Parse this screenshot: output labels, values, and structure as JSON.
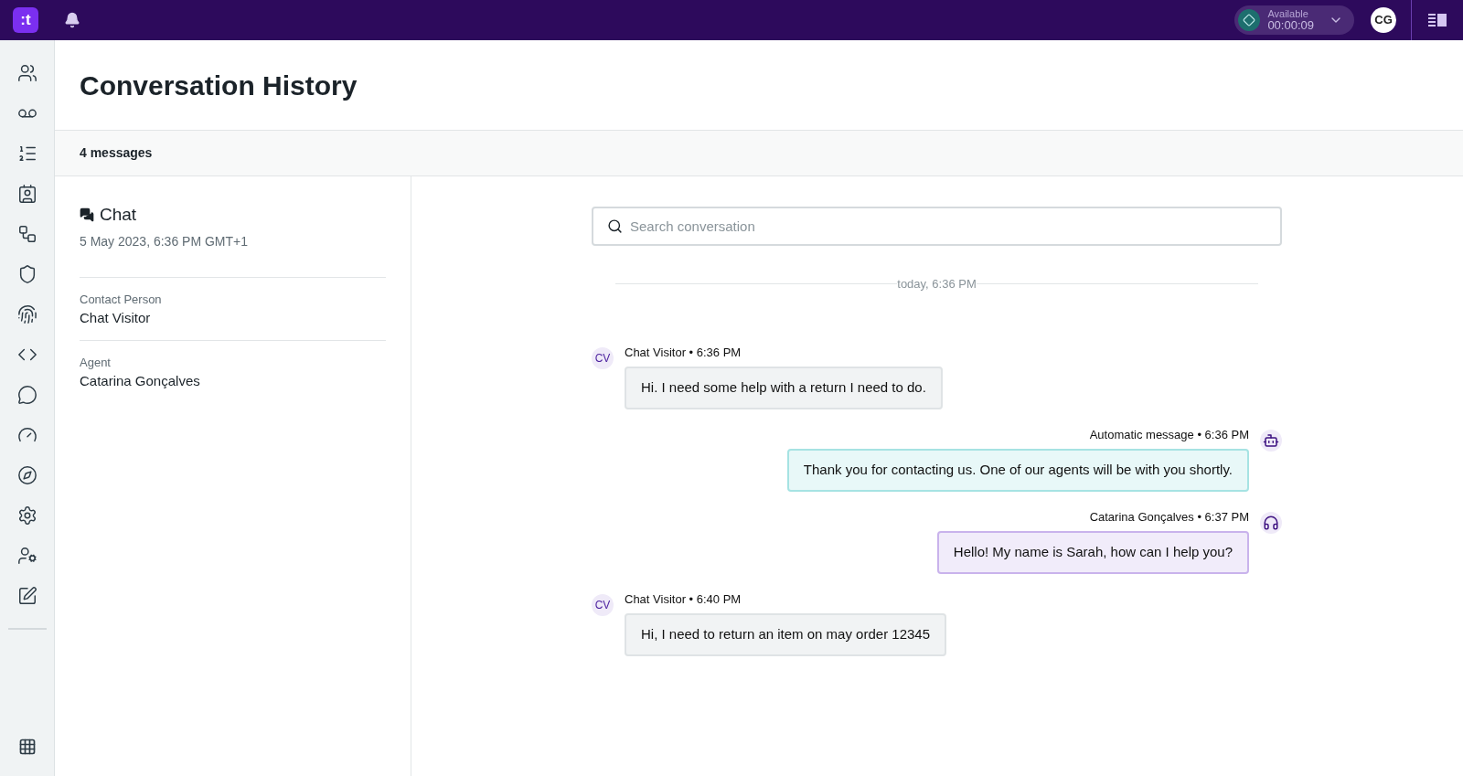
{
  "top_bar": {
    "logo": ":t",
    "status": {
      "label": "Available",
      "timer": "00:00:09"
    },
    "avatar": "CG"
  },
  "page": {
    "title": "Conversation History",
    "message_count": "4 messages"
  },
  "details": {
    "channel": "Chat",
    "date": "5 May 2023, 6:36 PM GMT+1",
    "fields": [
      {
        "label": "Contact Person",
        "value": "Chat Visitor"
      },
      {
        "label": "Agent",
        "value": "Catarina Gonçalves"
      }
    ]
  },
  "conversation": {
    "search": {
      "placeholder": "Search conversation"
    },
    "divider": "today, 6:36 PM",
    "messages": [
      {
        "kind": "visitor",
        "meta": "Chat Visitor • 6:36 PM",
        "avatar": "CV",
        "text": "Hi. I need some help with a return I need to do."
      },
      {
        "kind": "bot",
        "meta": "Automatic message • 6:36 PM",
        "text": "Thank you for contacting us. One of our agents will be with you shortly."
      },
      {
        "kind": "agent",
        "meta": "Catarina Gonçalves • 6:37 PM",
        "text": "Hello! My name is Sarah, how can I help you?"
      },
      {
        "kind": "visitor",
        "meta": "Chat Visitor • 6:40 PM",
        "avatar": "CV",
        "text": "Hi, I need to return an item on may order 12345"
      }
    ]
  }
}
